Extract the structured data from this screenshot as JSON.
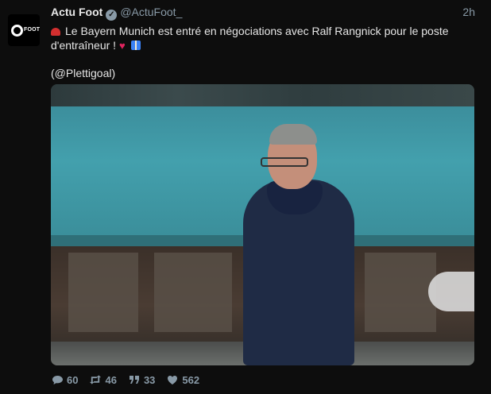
{
  "tweet": {
    "display_name": "Actu Foot",
    "handle": "@ActuFoot_",
    "time": "2h",
    "avatar_brand": "FOOT",
    "text_line1": "Le Bayern Munich est entré en négociations avec Ralf Rangnick pour le poste",
    "text_line2": "d'entraîneur !",
    "mention_open": "(",
    "mention": "@Plettigoal",
    "mention_close": ")"
  },
  "actions": {
    "replies": "60",
    "retweets": "46",
    "quotes": "33",
    "likes": "562"
  },
  "icons": {
    "verified": "verified-badge-icon",
    "reply": "reply-icon",
    "retweet": "retweet-icon",
    "quote": "quote-icon",
    "like": "heart-icon"
  },
  "colors": {
    "background": "#0d0d0d",
    "muted": "#8899a6",
    "heart_emoji": "#e0245e"
  }
}
